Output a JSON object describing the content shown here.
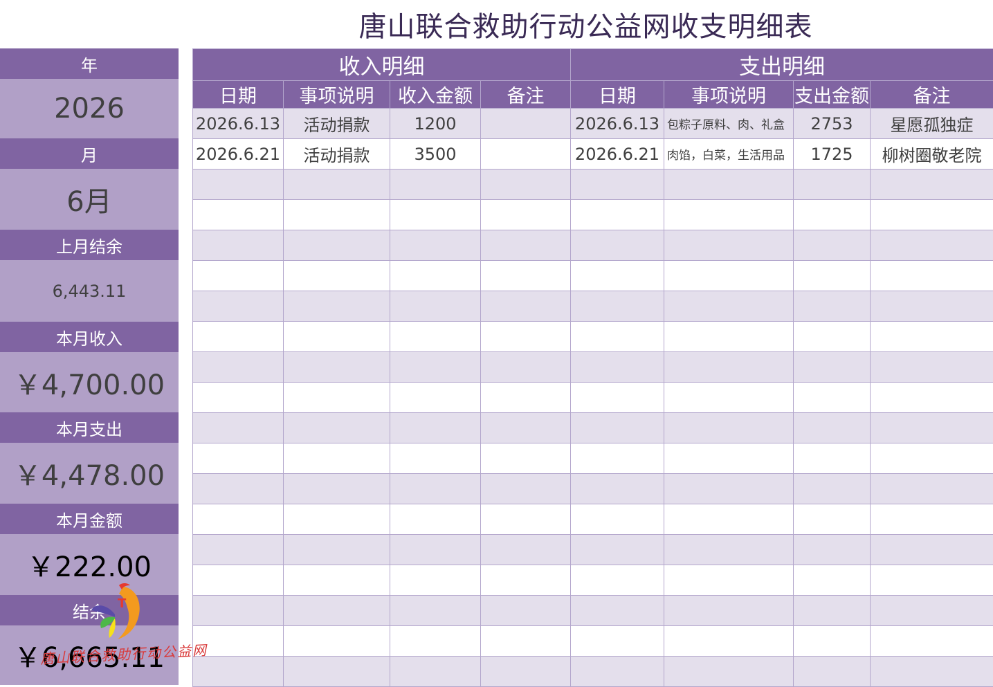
{
  "title": "唐山联合救助行动公益网收支明细表",
  "sidebar": {
    "year_label": "年",
    "year_value": "2026",
    "month_label": "月",
    "month_value": "6月",
    "prev_balance_label": "上月结余",
    "prev_balance_value": "6,443.11",
    "income_label": "本月收入",
    "income_value": "￥4,700.00",
    "expense_label": "本月支出",
    "expense_value": "￥4,478.00",
    "amount_label": "本月金额",
    "amount_value": "￥222.00",
    "balance_label": "结余",
    "balance_value": "￥6,665.11"
  },
  "income": {
    "section_title": "收入明细",
    "headers": [
      "日期",
      "事项说明",
      "收入金额",
      "备注"
    ],
    "rows": [
      [
        "2026.6.13",
        "活动捐款",
        "1200",
        ""
      ],
      [
        "2026.6.21",
        "活动捐款",
        "3500",
        ""
      ]
    ]
  },
  "expense": {
    "section_title": "支出明细",
    "headers": [
      "日期",
      "事项说明",
      "支出金额",
      "备注"
    ],
    "rows": [
      [
        "2026.6.13",
        "包粽子原料、肉、礼盒",
        "2753",
        "星愿孤独症"
      ],
      [
        "2026.6.21",
        "肉馅，白菜，生活用品",
        "1725",
        "柳树圈敬老院"
      ]
    ]
  },
  "watermark": "唐山联合救助行动公益网",
  "logo": {
    "icon": "butterfly-logo-icon",
    "letter": "T",
    "colors": [
      "#e63a2e",
      "#f39a1e",
      "#5a4ba8",
      "#4db848",
      "#f7e11a"
    ]
  },
  "colors": {
    "header": "#8064a2",
    "sidebar_value": "#b1a0c7",
    "band": "#e4dfec",
    "border": "#b3a6cc"
  }
}
